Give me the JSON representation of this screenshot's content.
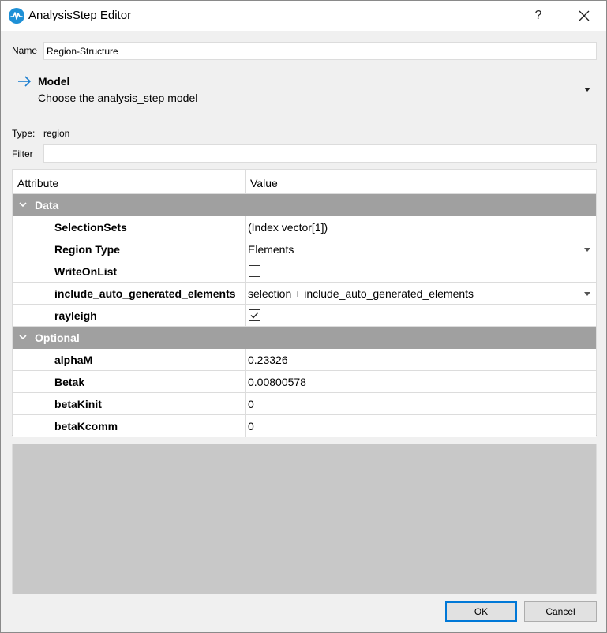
{
  "window": {
    "title": "AnalysisStep Editor",
    "help_glyph": "?",
    "icons": {
      "app": "waveform-icon",
      "close": "close-icon"
    }
  },
  "name_field": {
    "label": "Name",
    "value": "Region-Structure"
  },
  "model": {
    "title": "Model",
    "description": "Choose the analysis_step model",
    "icons": {
      "arrow": "arrow-right-icon",
      "dropdown": "caret-down-icon"
    }
  },
  "type": {
    "label": "Type:",
    "value": "region"
  },
  "filter": {
    "label": "Filter",
    "value": ""
  },
  "table": {
    "headers": {
      "attribute": "Attribute",
      "value": "Value"
    },
    "groups": [
      {
        "name": "Data",
        "rows": [
          {
            "attribute": "SelectionSets",
            "value": "(Index vector[1])"
          },
          {
            "attribute": "Region Type",
            "value": "Elements"
          },
          {
            "attribute": "WriteOnList",
            "checked": false
          },
          {
            "attribute": "include_auto_generated_elements",
            "value": "selection + include_auto_generated_elements"
          },
          {
            "attribute": "rayleigh",
            "checked": true
          }
        ]
      },
      {
        "name": "Optional",
        "rows": [
          {
            "attribute": "alphaM",
            "value": "0.23326"
          },
          {
            "attribute": "Betak",
            "value": "0.00800578"
          },
          {
            "attribute": "betaKinit",
            "value": "0"
          },
          {
            "attribute": "betaKcomm",
            "value": "0"
          }
        ]
      }
    ]
  },
  "buttons": {
    "ok": "OK",
    "cancel": "Cancel"
  },
  "colors": {
    "group_header": "#a0a0a0",
    "accent": "#0078d7",
    "empty_panel": "#c8c8c8"
  }
}
